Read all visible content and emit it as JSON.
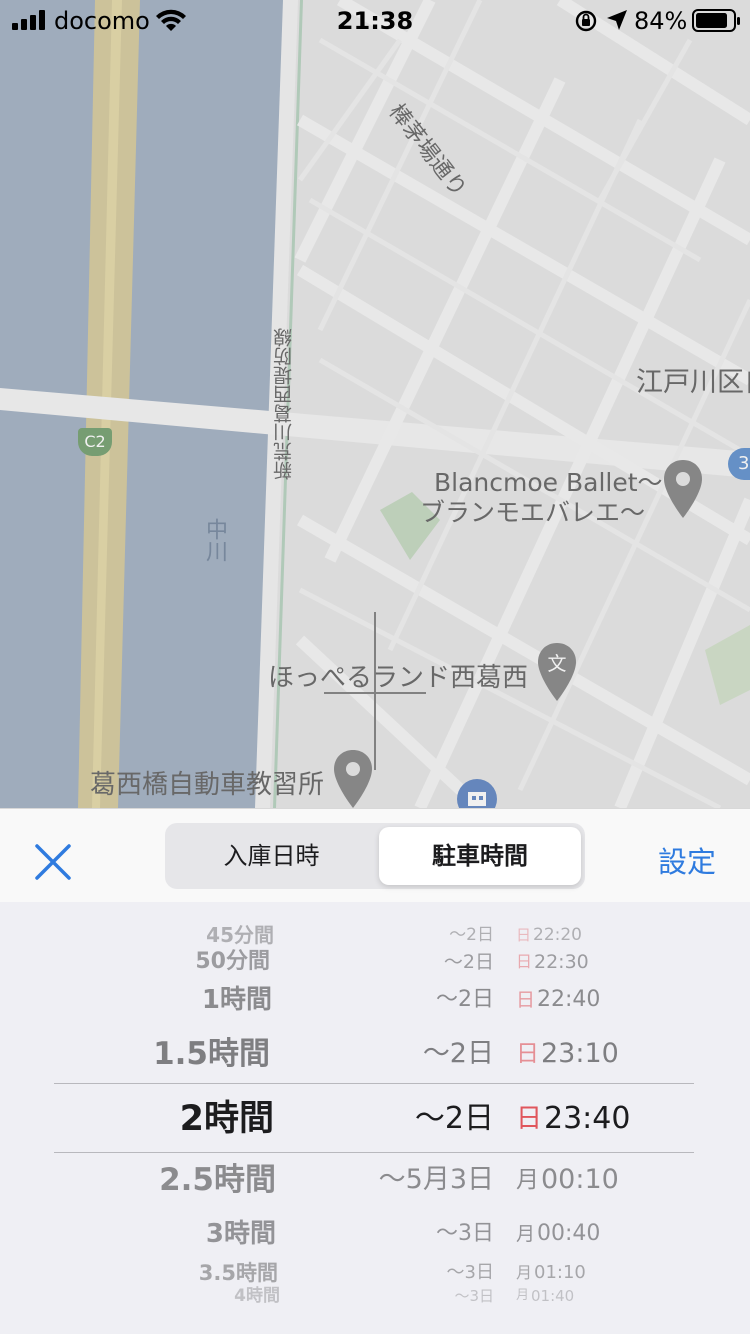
{
  "status_bar": {
    "carrier": "docomo",
    "time": "21:38",
    "battery_percent": "84%"
  },
  "map": {
    "labels": {
      "street_top": "棒茅場通り",
      "district": "江戸川区自",
      "poi_ballet_line1": "Blancmoe Ballet〜",
      "poi_ballet_line2": "ブランモエバレエ〜",
      "poi_school": "ほっぺるランド西葛西",
      "poi_driving_school": "葛西橋自動車教習所",
      "river": "中川",
      "embankment": "新荒川葛西堤防線",
      "route_badge": "C2",
      "edge_badge": "3"
    }
  },
  "toolbar": {
    "close_icon": "close-icon",
    "segments": [
      "入庫日時",
      "駐車時間"
    ],
    "selected_segment": 1,
    "set_label": "設定"
  },
  "picker": {
    "rows": [
      {
        "duration": "45分間",
        "day": "〜2日",
        "weekday": "日",
        "time": "22:20"
      },
      {
        "duration": "50分間",
        "day": "〜2日",
        "weekday": "日",
        "time": "22:30"
      },
      {
        "duration": "1時間",
        "day": "〜2日",
        "weekday": "日",
        "time": "22:40"
      },
      {
        "duration": "1.5時間",
        "day": "〜2日",
        "weekday": "日",
        "time": "23:10"
      },
      {
        "duration": "2時間",
        "day": "〜2日",
        "weekday": "日",
        "time": "23:40"
      },
      {
        "duration": "2.5時間",
        "day": "〜5月3日",
        "weekday": "月",
        "time": "00:10"
      },
      {
        "duration": "3時間",
        "day": "〜3日",
        "weekday": "月",
        "time": "00:40"
      },
      {
        "duration": "3.5時間",
        "day": "〜3日",
        "weekday": "月",
        "time": "01:10"
      },
      {
        "duration": "4時間",
        "day": "〜3日",
        "weekday": "月",
        "time": "01:40"
      }
    ],
    "selected_index": 4,
    "colors": {
      "sunday": "#e0565c",
      "text": "#1c1c1e",
      "accent": "#2f7bdf"
    }
  }
}
